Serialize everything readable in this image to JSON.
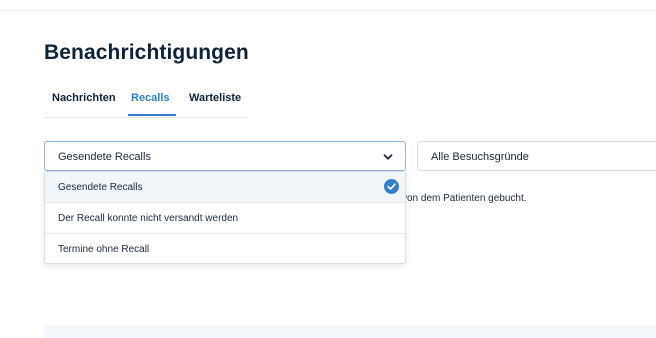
{
  "page": {
    "title": "Benachrichtigungen"
  },
  "tabs": [
    {
      "label": "Nachrichten",
      "active": false
    },
    {
      "label": "Recalls",
      "active": true
    },
    {
      "label": "Warteliste",
      "active": false
    }
  ],
  "filters": {
    "recall_status": {
      "selected": "Gesendete Recalls",
      "options": [
        {
          "label": "Gesendete Recalls",
          "selected": true
        },
        {
          "label": "Der Recall konnte nicht versandt werden",
          "selected": false
        },
        {
          "label": "Termine ohne Recall",
          "selected": false
        }
      ]
    },
    "visit_reason": {
      "selected": "Alle Besuchsgründe"
    }
  },
  "content": {
    "partial_text": "von dem Patienten gebucht."
  },
  "icons": {
    "dropdown": "chevron-down-icon",
    "selected": "check-circle-icon"
  },
  "colors": {
    "accent": "#2f80c9",
    "title": "#0f2338",
    "selected_bg": "#f1f6fb"
  }
}
